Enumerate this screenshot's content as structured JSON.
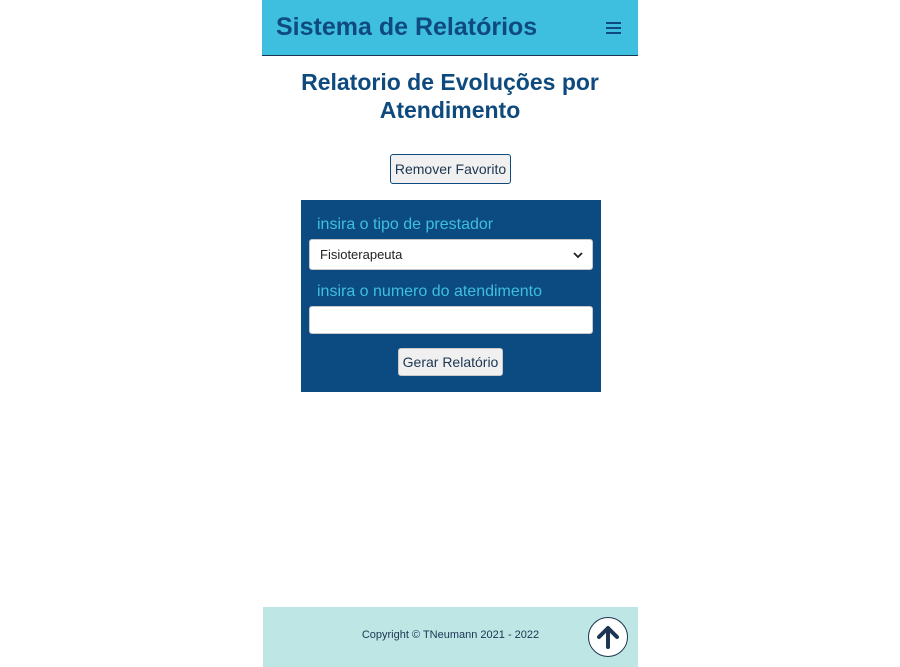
{
  "header": {
    "brand": "Sistema de Relatórios",
    "menu_icon": "hamburger-menu-icon"
  },
  "page": {
    "title": "Relatorio de Evoluções por Atendimento"
  },
  "favorite": {
    "remove_label": "Remover Favorito"
  },
  "form": {
    "provider_label": "insira o tipo de prestador",
    "provider_selected": "Fisioterapeuta",
    "attendance_label": "insira o numero do atendimento",
    "attendance_value": "",
    "submit_label": "Gerar Relatório"
  },
  "footer": {
    "copyright": "Copyright © TNeumann 2021 - 2022",
    "top_icon": "arrow-up-icon"
  },
  "colors": {
    "header_bg": "#3fbfe0",
    "primary": "#0e4a7e",
    "form_bg": "#0b4b81",
    "footer_bg": "#bde6e5"
  }
}
